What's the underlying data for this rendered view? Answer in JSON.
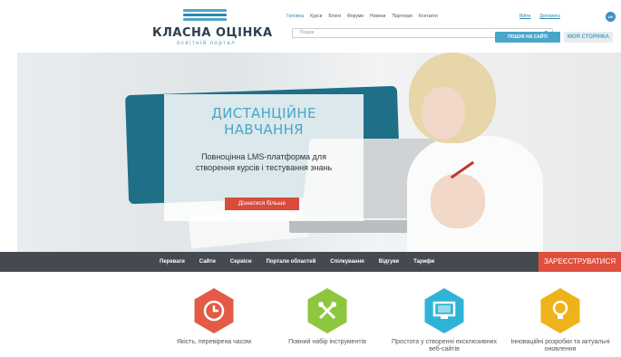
{
  "logo": {
    "title": "КЛАСНА ОЦІНКА",
    "subtitle": "освітній портал"
  },
  "nav": [
    "Головна",
    "Курси",
    "Блоги",
    "Форуми",
    "Новини",
    "Партнери",
    "Контакти"
  ],
  "auth": {
    "login": "Війти",
    "register": "Допомога",
    "lang": "UK"
  },
  "search": {
    "placeholder": "Пошук",
    "button": "ПОШУК НА САЙТІ",
    "my_page": "МОЯ СТОРІНКА"
  },
  "hero": {
    "title_line1": "ДИСТАНЦІЙНЕ",
    "title_line2": "НАВЧАННЯ",
    "text": "Повноцінна LMS-платформа для створення курсів і тестування знань",
    "button": "Дізнатися більше"
  },
  "bar": {
    "links": [
      "Переваги",
      "Сайти",
      "Сервіси",
      "Портали областей",
      "Спілкування",
      "Відгуки",
      "Тарифи"
    ],
    "register": "ЗАРЕЄСТРУВАТИСЯ"
  },
  "features": [
    {
      "icon": "clock-icon",
      "color": "#e35b46",
      "label": "Якість, перевірена часом"
    },
    {
      "icon": "tools-icon",
      "color": "#8dc63f",
      "label": "Повний набір інструментів"
    },
    {
      "icon": "monitor-icon",
      "color": "#2fb4d7",
      "label": "Простота у створенні ексклюзивних веб-сайтів"
    },
    {
      "icon": "lightbulb-icon",
      "color": "#f0b21a",
      "label": "Інноваційні розробки та актуальні оновлення"
    }
  ]
}
